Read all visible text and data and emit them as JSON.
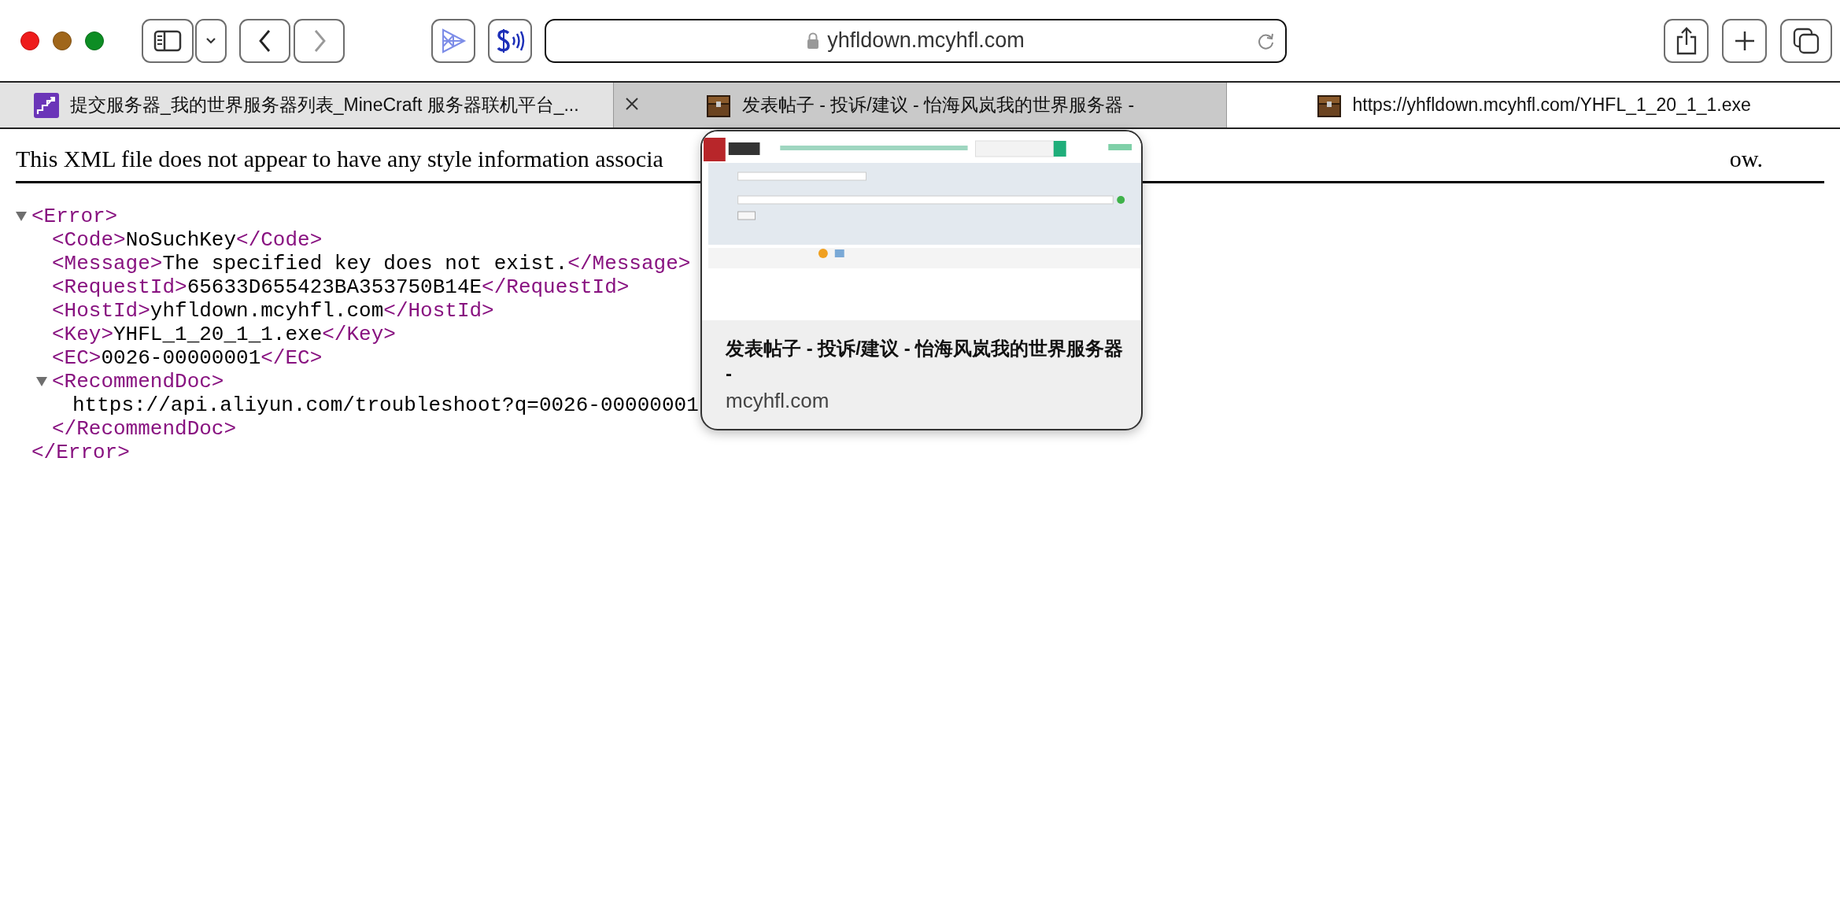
{
  "toolbar": {
    "address": "yhfldown.mcyhfl.com"
  },
  "tabs": [
    {
      "title": "提交服务器_我的世界服务器列表_MineCraft 服务器联机平台_...",
      "selected": false,
      "hovered": false
    },
    {
      "title": "发表帖子 - 投诉/建议 - 怡海风岚我的世界服务器 -",
      "selected": false,
      "hovered": true
    },
    {
      "title": "https://yhfldown.mcyhfl.com/YHFL_1_20_1_1.exe",
      "selected": true,
      "hovered": false
    }
  ],
  "document": {
    "notice_start": "This XML file does not appear to have any style information associa",
    "notice_end": "ow.",
    "tree": [
      {
        "open": "<Error>",
        "expanded": true,
        "close": "</Error>",
        "children": [
          {
            "open": "<Code>",
            "text": "NoSuchKey",
            "close": "</Code>"
          },
          {
            "open": "<Message>",
            "text": "The specified key does not exist.",
            "close": "</Message>"
          },
          {
            "open": "<RequestId>",
            "text": "65633D655423BA353750B14E",
            "close": "</RequestId>"
          },
          {
            "open": "<HostId>",
            "text": "yhfldown.mcyhfl.com",
            "close": "</HostId>"
          },
          {
            "open": "<Key>",
            "text": "YHFL_1_20_1_1.exe",
            "close": "</Key>"
          },
          {
            "open": "<EC>",
            "text": "0026-00000001",
            "close": "</EC>"
          },
          {
            "open": "<RecommendDoc>",
            "expanded": true,
            "close": "</RecommendDoc>",
            "children": [
              {
                "text": "https://api.aliyun.com/troubleshoot?q=0026-00000001"
              }
            ]
          }
        ]
      }
    ]
  },
  "tab_preview": {
    "title": "发表帖子 - 投诉/建议 - 怡海风岚我的世界服务器 -",
    "domain": "mcyhfl.com"
  }
}
